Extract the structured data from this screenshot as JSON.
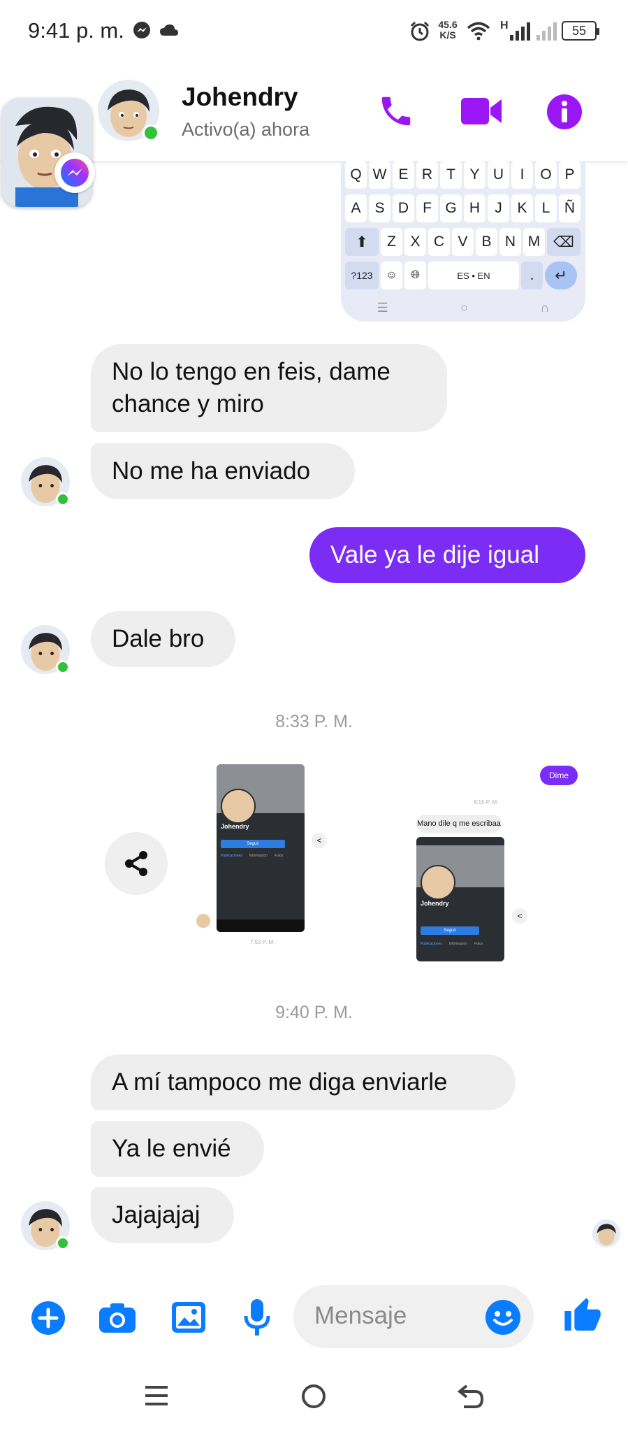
{
  "status_bar": {
    "time": "9:41 p. m.",
    "net_speed_value": "45.6",
    "net_speed_unit": "K/S",
    "signal_label": "H",
    "battery": "55"
  },
  "header": {
    "contact_name": "Johendry",
    "contact_status": "Activo(a) ahora"
  },
  "keyboard": {
    "row1": [
      "Q",
      "W",
      "E",
      "R",
      "T",
      "Y",
      "U",
      "I",
      "O",
      "P"
    ],
    "row2": [
      "A",
      "S",
      "D",
      "F",
      "G",
      "H",
      "J",
      "K",
      "L",
      "Ñ"
    ],
    "row3": [
      "Z",
      "X",
      "C",
      "V",
      "B",
      "N",
      "M"
    ],
    "symbols_key": "?123",
    "lang_key": "ES • EN",
    "period_key": "."
  },
  "messages": [
    {
      "id": "m1",
      "sender": "contact",
      "text": "No lo tengo en feis, dame chance y miro"
    },
    {
      "id": "m2",
      "sender": "contact",
      "text": "No me ha enviado"
    },
    {
      "id": "m3",
      "sender": "me",
      "text": "Vale ya le dije igual"
    },
    {
      "id": "m4",
      "sender": "contact",
      "text": "Dale bro"
    }
  ],
  "timestamps": [
    "8:33 P. M.",
    "9:40 P. M."
  ],
  "shared_image": {
    "shot1": {
      "name": "Johendry",
      "time": "7:53 P. M.",
      "button": "Seguir",
      "tab1": "Publicaciones",
      "tab2": "Información",
      "tab3": "Fotos"
    },
    "shot2": {
      "bubble_me": "Dime",
      "time": "8:15 P. M.",
      "bubble_contact": "Mano dile q me escribaa",
      "name": "Johendry",
      "button": "Seguir",
      "tab1": "Publicaciones",
      "tab2": "Información",
      "tab3": "Fotos"
    }
  },
  "messages_late": [
    {
      "id": "m5",
      "sender": "contact",
      "text": "A mí tampoco me diga enviarle"
    },
    {
      "id": "m6",
      "sender": "contact",
      "text": "Ya le envié"
    },
    {
      "id": "m7",
      "sender": "contact",
      "text": "Jajajajaj"
    }
  ],
  "composer": {
    "placeholder": "Mensaje"
  },
  "colors": {
    "accent": "#9b16f5",
    "blue": "#0a7cff",
    "bubble_me": "#7b2cf5",
    "online": "#32c13a"
  }
}
